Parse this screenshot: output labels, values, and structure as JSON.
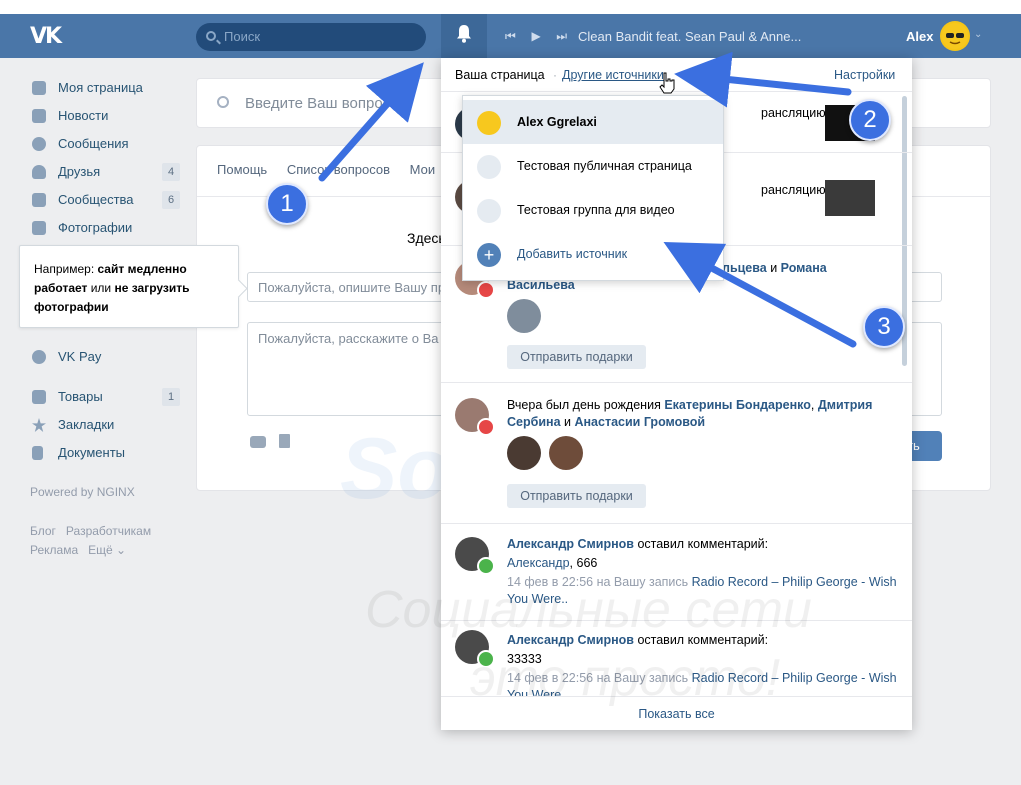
{
  "header": {
    "logo": "VK",
    "search_placeholder": "Поиск",
    "track": "Clean Bandit feat. Sean Paul & Anne...",
    "user_name": "Alex"
  },
  "sidebar": {
    "items": [
      {
        "label": "Моя страница",
        "count": ""
      },
      {
        "label": "Новости",
        "count": ""
      },
      {
        "label": "Сообщения",
        "count": ""
      },
      {
        "label": "Друзья",
        "count": "4"
      },
      {
        "label": "Сообщества",
        "count": "6"
      },
      {
        "label": "Фотографии",
        "count": ""
      }
    ],
    "vkpay": "VK Pay",
    "items2": [
      {
        "label": "Товары",
        "count": "1"
      },
      {
        "label": "Закладки",
        "count": ""
      },
      {
        "label": "Документы",
        "count": ""
      }
    ],
    "powered": "Powered by NGINX",
    "footer1": "Блог   Разработчикам",
    "footer2": "Реклама   Ещё ⌄"
  },
  "tooltip": {
    "p1": "Например: ",
    "b1": "сайт медленно работает",
    "p2": " или ",
    "b2": "не загрузить фотографии"
  },
  "main": {
    "search_placeholder": "Введите Ваш вопрос",
    "tabs": [
      "Помощь",
      "Список вопросов",
      "Мои"
    ],
    "title_partial": "Здесь",
    "input1_placeholder": "Пожалуйста, опишите Вашу пр",
    "input2_placeholder": "Пожалуйста, расскажите о Ва",
    "send_partial": "ть"
  },
  "notifications": {
    "tab_your": "Ваша страница",
    "tab_dot": "·",
    "tab_other": "Другие источники",
    "settings": "Настройки",
    "rows": [
      {
        "text_tail": "рансляцию"
      },
      {
        "text_tail": "рансляцию"
      },
      {
        "name1_tail": "льцева",
        "and": " и ",
        "name2": "Романа Васильева",
        "button": "Отправить подарки"
      },
      {
        "prefix": "Вчера был день рождения ",
        "name1": "Екатерины Бондаренко",
        "sep": ", ",
        "name2": "Дмитрия Сербина",
        "and": " и ",
        "name3": "Анастасии Громовой",
        "button": "Отправить подарки"
      },
      {
        "author": "Александр Смирнов",
        "action": " оставил комментарий:",
        "comment_link": "Александр",
        "comment_rest": ", 666",
        "time": "14 фев в 22:56 на Вашу запись ",
        "post": "Radio Record – Philip George - Wish You Were.."
      },
      {
        "author": "Александр Смирнов",
        "action": " оставил комментарий:",
        "comment": "33333",
        "time": "14 фев в 22:56 на Вашу запись ",
        "post": "Radio Record – Philip George - Wish You Were.."
      }
    ],
    "show_all": "Показать все"
  },
  "sources_menu": {
    "items": [
      {
        "label": "Alex Ggrelaxi"
      },
      {
        "label": "Тестовая публичная страница"
      },
      {
        "label": "Тестовая группа для видео"
      },
      {
        "label": "Добавить источник"
      }
    ]
  },
  "callouts": [
    "1",
    "2",
    "3"
  ],
  "watermark": {
    "line1": "SocFAQ.ru",
    "line2": "Социальные сети",
    "line3": "это просто!"
  },
  "colors": {
    "header": "#4a76a8",
    "accent": "#2a5885",
    "callout": "#3b6fe0"
  }
}
